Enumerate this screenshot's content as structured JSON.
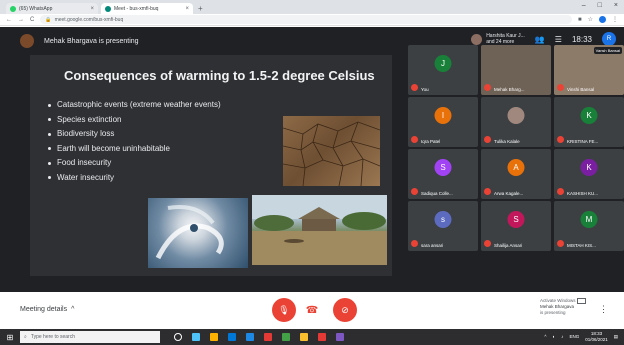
{
  "browser": {
    "tabs": [
      {
        "title": "(65) WhatsApp",
        "active": false
      },
      {
        "title": "Meet - bus-xmfi-buq",
        "active": true
      }
    ],
    "url": "meet.google.com/bus-xmfi-buq"
  },
  "meet": {
    "presenter_text": "Mehak Bhargava is presenting",
    "participants_summary": {
      "line1": "Harshita Kaur J...",
      "line2": "and 24 more"
    },
    "time": "18:33",
    "self_avatar": "R"
  },
  "slide": {
    "title": "Consequences of warming to 1.5-2 degree Celsius",
    "bullets": [
      "Catastrophic events (extreme weather events)",
      "Species extinction",
      "Biodiversity loss",
      "Earth will become uninhabitable",
      "Food insecurity",
      "Water insecurity"
    ]
  },
  "participants": [
    {
      "initial": "J",
      "name": "You",
      "color": "#188038"
    },
    {
      "initial": "",
      "name": "Mehak Bharg...",
      "color": "#6e6155",
      "video": true
    },
    {
      "initial": "",
      "name": "Vinshi Bansal",
      "color": "#8d7b6a",
      "video": true,
      "badge": "Vansh Bansal"
    },
    {
      "initial": "I",
      "name": "Iqra Patel",
      "color": "#e8710a"
    },
    {
      "initial": "",
      "name": "Tulika Kalale",
      "color": "#3c4043",
      "photo": true
    },
    {
      "initial": "K",
      "name": "KRISTINA FE...",
      "color": "#188038"
    },
    {
      "initial": "S",
      "name": "Sadiqua Colle...",
      "color": "#a142f4"
    },
    {
      "initial": "A",
      "name": "Arwa Kagale...",
      "color": "#e8710a"
    },
    {
      "initial": "K",
      "name": "KASHISH KU...",
      "color": "#7b1fa2"
    },
    {
      "initial": "s",
      "name": "sara ansari",
      "color": "#5c6bc0"
    },
    {
      "initial": "S",
      "name": "Shailija Ansari",
      "color": "#c2185b"
    },
    {
      "initial": "M",
      "name": "MISTAH KIS...",
      "color": "#188038"
    }
  ],
  "bottom": {
    "meeting_details": "Meeting details",
    "meeting_details_chevron": "^",
    "present_line1": "Activate Windows",
    "present_name": "Mehak Bhargava",
    "present_line2": "is presenting"
  },
  "taskbar": {
    "search_placeholder": "Type here to search",
    "lang": "ENG",
    "time": "18:33",
    "date": "01/06/2021",
    "icon_colors": [
      "#ffffff",
      "#4fc3f7",
      "#ffb300",
      "#0078d7",
      "#1e88e5",
      "#e53935",
      "#43a047",
      "#fbc02d",
      "#e53935",
      "#7e57c2"
    ]
  }
}
